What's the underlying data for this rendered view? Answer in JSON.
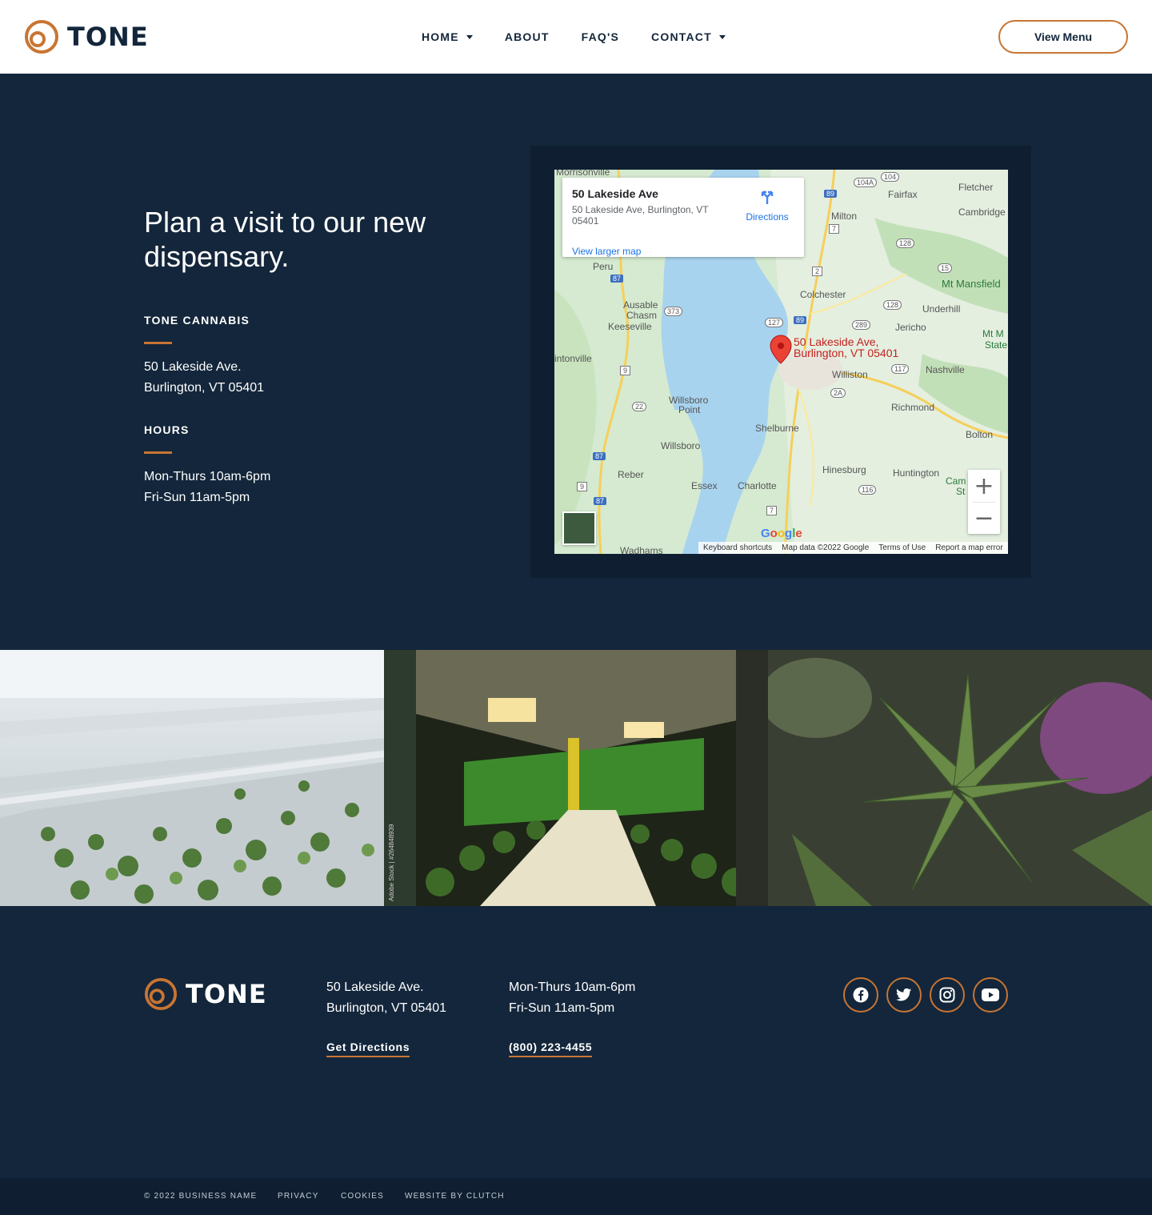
{
  "brand": {
    "name": "TONE",
    "accent": "#c87533",
    "navy": "#13263b"
  },
  "nav": {
    "items": [
      {
        "label": "HOME",
        "has_dropdown": true
      },
      {
        "label": "ABOUT",
        "has_dropdown": false
      },
      {
        "label": "FAQ'S",
        "has_dropdown": false
      },
      {
        "label": "CONTACT",
        "has_dropdown": true
      }
    ],
    "cta_label": "View Menu"
  },
  "visit": {
    "title": "Plan a visit to our new dispensary.",
    "location_label": "TONE CANNABIS",
    "address_line1": "50 Lakeside Ave.",
    "address_line2": "Burlington, VT 05401",
    "hours_label": "HOURS",
    "hours_line1": "Mon-Thurs 10am-6pm",
    "hours_line2": "Fri-Sun 11am-5pm"
  },
  "map": {
    "popup_title": "50 Lakeside Ave",
    "popup_address": "50 Lakeside Ave, Burlington, VT 05401",
    "popup_link": "View larger map",
    "directions_label": "Directions",
    "pin_label_line1": "50 Lakeside Ave,",
    "pin_label_line2": "Burlington, VT 05401",
    "zoom_in": "+",
    "zoom_out": "−",
    "google": "Google",
    "footer": {
      "shortcuts": "Keyboard shortcuts",
      "data": "Map data ©2022 Google",
      "terms": "Terms of Use",
      "report": "Report a map error"
    },
    "places": {
      "morrisonville": "Morrisonville",
      "fairfax": "Fairfax",
      "fletcher": "Fletcher",
      "milton": "Milton",
      "cambridge": "Cambridge",
      "peru": "Peru",
      "mt_mansfield": "Mt Mansfield",
      "colchester": "Colchester",
      "ausable": "Ausable",
      "chasm": "Chasm",
      "keeseville": "Keeseville",
      "underhill": "Underhill",
      "jericho": "Jericho",
      "mt_m": "Mt M",
      "state": "State",
      "intonville": "intonville",
      "williston": "Williston",
      "nashville": "Nashville",
      "willsboro_point_1": "Willsboro",
      "willsboro_point_2": "Point",
      "richmond": "Richmond",
      "shelburne": "Shelburne",
      "bolton": "Bolton",
      "willsboro": "Willsboro",
      "reber": "Reber",
      "essex": "Essex",
      "charlotte": "Charlotte",
      "hinesburg": "Hinesburg",
      "huntington": "Huntington",
      "cam": "Cam",
      "st": "St",
      "wadhams": "Wadhams"
    },
    "shields": {
      "r104": "104",
      "r104a": "104A",
      "r89a": "89",
      "r7": "7",
      "r128a": "128",
      "r15": "15",
      "r2": "2",
      "r87a": "87",
      "r373": "373",
      "r128b": "128",
      "r127": "127",
      "r89b": "89",
      "r289": "289",
      "r9a": "9",
      "r117": "117",
      "r2a": "2A",
      "r22": "22",
      "r87b": "87",
      "r9b": "9",
      "r87c": "87",
      "r116": "116",
      "r7b": "7"
    }
  },
  "footer": {
    "address_line1": "50 Lakeside Ave.",
    "address_line2": "Burlington, VT 05401",
    "hours_line1": "Mon-Thurs 10am-6pm",
    "hours_line2": "Fri-Sun 11am-5pm",
    "directions_link": "Get Directions",
    "phone_link": "(800) 223-4455",
    "social": [
      "facebook-icon",
      "twitter-icon",
      "instagram-icon",
      "youtube-icon"
    ],
    "bottom": {
      "copyright": "© 2022 BUSINESS NAME",
      "privacy": "PRIVACY",
      "cookies": "COOKIES",
      "credit": "WEBSITE BY CLUTCH"
    }
  },
  "photos": {
    "watermark": "Adobe Stock | #264848939"
  }
}
